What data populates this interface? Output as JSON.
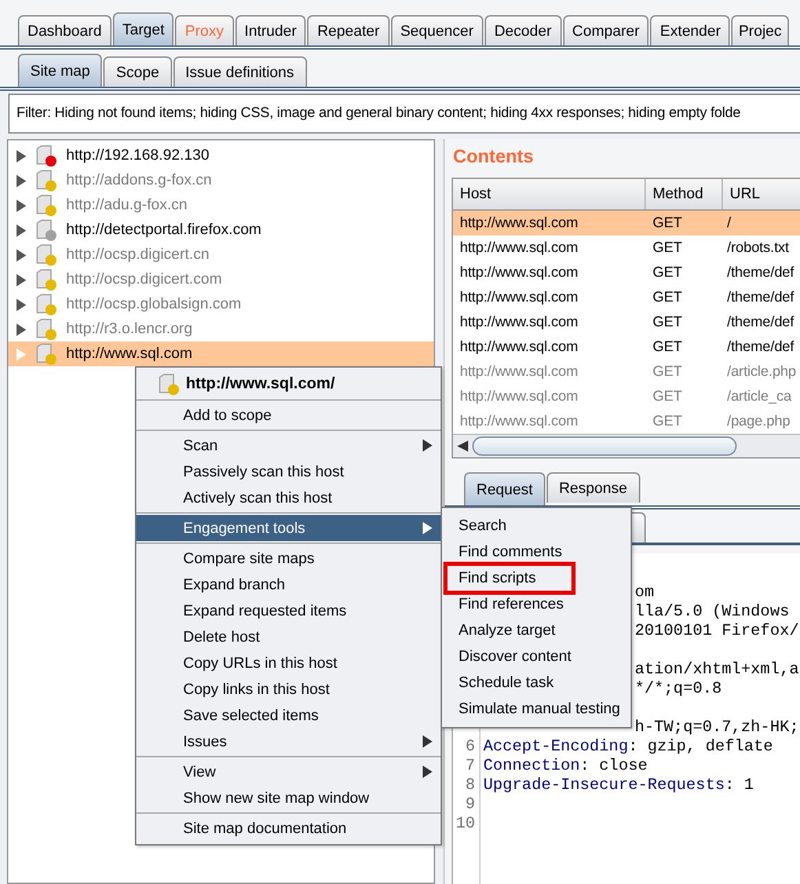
{
  "top_tabs": [
    {
      "label": "Dashboard",
      "selected": false,
      "alert": false
    },
    {
      "label": "Target",
      "selected": true,
      "alert": false
    },
    {
      "label": "Proxy",
      "selected": false,
      "alert": true
    },
    {
      "label": "Intruder",
      "selected": false,
      "alert": false
    },
    {
      "label": "Repeater",
      "selected": false,
      "alert": false
    },
    {
      "label": "Sequencer",
      "selected": false,
      "alert": false
    },
    {
      "label": "Decoder",
      "selected": false,
      "alert": false
    },
    {
      "label": "Comparer",
      "selected": false,
      "alert": false
    },
    {
      "label": "Extender",
      "selected": false,
      "alert": false
    },
    {
      "label": "Projec",
      "selected": false,
      "alert": false
    }
  ],
  "sub_tabs": [
    {
      "label": "Site map",
      "selected": true
    },
    {
      "label": "Scope",
      "selected": false
    },
    {
      "label": "Issue definitions",
      "selected": false
    }
  ],
  "filter": "Filter: Hiding not found items;  hiding CSS, image and general binary content;  hiding 4xx responses;  hiding empty folde",
  "site_map": {
    "items": [
      {
        "label": "http://192.168.92.130",
        "color": "#e8000b",
        "requested": true,
        "selected": false
      },
      {
        "label": "http://addons.g-fox.cn",
        "color": "#e6b800",
        "requested": false,
        "selected": false
      },
      {
        "label": "http://adu.g-fox.cn",
        "color": "#e6b800",
        "requested": false,
        "selected": false
      },
      {
        "label": "http://detectportal.firefox.com",
        "color": "#a0a0a0",
        "requested": true,
        "selected": false
      },
      {
        "label": "http://ocsp.digicert.cn",
        "color": "#e6b800",
        "requested": false,
        "selected": false
      },
      {
        "label": "http://ocsp.digicert.com",
        "color": "#e6b800",
        "requested": false,
        "selected": false
      },
      {
        "label": "http://ocsp.globalsign.com",
        "color": "#e6b800",
        "requested": false,
        "selected": false
      },
      {
        "label": "http://r3.o.lencr.org",
        "color": "#e6b800",
        "requested": false,
        "selected": false
      },
      {
        "label": "http://www.sql.com",
        "color": "#e6b800",
        "requested": true,
        "selected": true
      }
    ]
  },
  "contents": {
    "title": "Contents",
    "columns": [
      "Host",
      "Method",
      "URL"
    ],
    "rows": [
      {
        "cells": [
          "http://www.sql.com",
          "GET",
          "/"
        ],
        "selected": true,
        "requested": true
      },
      {
        "cells": [
          "http://www.sql.com",
          "GET",
          "/robots.txt"
        ],
        "selected": false,
        "requested": true
      },
      {
        "cells": [
          "http://www.sql.com",
          "GET",
          "/theme/def"
        ],
        "selected": false,
        "requested": true
      },
      {
        "cells": [
          "http://www.sql.com",
          "GET",
          "/theme/def"
        ],
        "selected": false,
        "requested": true
      },
      {
        "cells": [
          "http://www.sql.com",
          "GET",
          "/theme/def"
        ],
        "selected": false,
        "requested": true
      },
      {
        "cells": [
          "http://www.sql.com",
          "GET",
          "/theme/def"
        ],
        "selected": false,
        "requested": true
      },
      {
        "cells": [
          "http://www.sql.com",
          "GET",
          "/article.php"
        ],
        "selected": false,
        "requested": false
      },
      {
        "cells": [
          "http://www.sql.com",
          "GET",
          "/article_ca"
        ],
        "selected": false,
        "requested": false
      },
      {
        "cells": [
          "http://www.sql.com",
          "GET",
          "/page.php"
        ],
        "selected": false,
        "requested": false
      }
    ]
  },
  "message_tabs": [
    {
      "label": "Request",
      "selected": true
    },
    {
      "label": "Response",
      "selected": false
    }
  ],
  "editor": {
    "lines": [
      {
        "kind": "hidden"
      },
      {
        "kind": "clipped",
        "text": "om"
      },
      {
        "kind": "clipped",
        "text": "lla/5.0 (Windows"
      },
      {
        "kind": "clipped",
        "text": "20100101 Firefox/"
      },
      {
        "kind": "hidden"
      },
      {
        "kind": "clipped",
        "text": "ation/xhtml+xml,a"
      },
      {
        "kind": "clipped",
        "text": "*/*;q=0.8"
      },
      {
        "kind": "hidden"
      },
      {
        "kind": "clipped",
        "text": "h-TW;q=0.7,zh-HK;"
      },
      {
        "kind": "header",
        "number": "6",
        "name": "Accept-Encoding",
        "value": ": gzip, deflate"
      },
      {
        "kind": "header",
        "number": "7",
        "name": "Connection",
        "value": ": close"
      },
      {
        "kind": "header",
        "number": "8",
        "name": "Upgrade-Insecure-Requests",
        "value": ": 1"
      },
      {
        "kind": "blank",
        "number": "9"
      },
      {
        "kind": "blank",
        "number": "10"
      }
    ]
  },
  "context_menu": {
    "title": "http://www.sql.com/",
    "groups": [
      [
        {
          "label": "Add to scope",
          "submenu": false,
          "selected": false
        }
      ],
      [
        {
          "label": "Scan",
          "submenu": true,
          "selected": false
        },
        {
          "label": "Passively scan this host",
          "submenu": false,
          "selected": false
        },
        {
          "label": "Actively scan this host",
          "submenu": false,
          "selected": false
        }
      ],
      [
        {
          "label": "Engagement tools",
          "submenu": true,
          "selected": true
        }
      ],
      [
        {
          "label": "Compare site maps",
          "submenu": false,
          "selected": false
        },
        {
          "label": "Expand branch",
          "submenu": false,
          "selected": false
        },
        {
          "label": "Expand requested items",
          "submenu": false,
          "selected": false
        },
        {
          "label": "Delete host",
          "submenu": false,
          "selected": false
        },
        {
          "label": "Copy URLs in this host",
          "submenu": false,
          "selected": false
        },
        {
          "label": "Copy links in this host",
          "submenu": false,
          "selected": false
        },
        {
          "label": "Save selected items",
          "submenu": false,
          "selected": false
        },
        {
          "label": "Issues",
          "submenu": true,
          "selected": false
        }
      ],
      [
        {
          "label": "View",
          "submenu": true,
          "selected": false
        },
        {
          "label": "Show new site map window",
          "submenu": false,
          "selected": false
        }
      ],
      [
        {
          "label": "Site map documentation",
          "submenu": false,
          "selected": false
        }
      ]
    ]
  },
  "submenu": {
    "items": [
      {
        "label": "Search",
        "annotated": false
      },
      {
        "label": "Find comments",
        "annotated": false
      },
      {
        "label": "Find scripts",
        "annotated": true
      },
      {
        "label": "Find references",
        "annotated": false
      },
      {
        "label": "Analyze target",
        "annotated": false
      },
      {
        "label": "Discover content",
        "annotated": false
      },
      {
        "label": "Schedule task",
        "annotated": false
      },
      {
        "label": "Simulate manual testing",
        "annotated": false
      }
    ]
  }
}
